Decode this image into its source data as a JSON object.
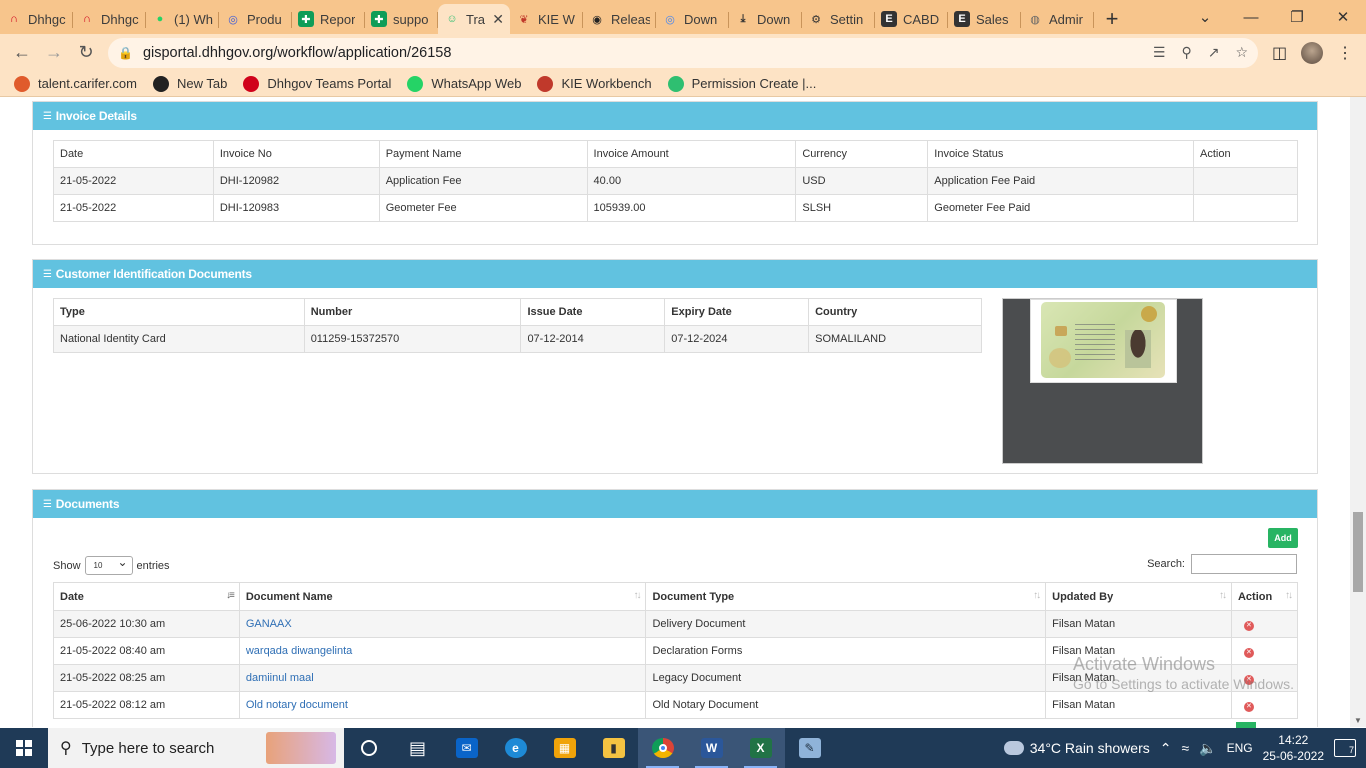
{
  "browser": {
    "tabs": [
      {
        "label": "Dhhgc",
        "icon": "dhhgov-icon",
        "color": "#d0021b"
      },
      {
        "label": "Dhhgc",
        "icon": "dhhgov-icon",
        "color": "#d0021b"
      },
      {
        "label": "(1) Wh",
        "icon": "whatsapp-icon",
        "color": "#25d366"
      },
      {
        "label": "Produ",
        "icon": "product-icon",
        "color": "#3b5bdb"
      },
      {
        "label": "Repor",
        "icon": "sheets-icon",
        "color": "#0f9d58"
      },
      {
        "label": "suppo",
        "icon": "sheets-icon",
        "color": "#0f9d58"
      },
      {
        "label": "Tra",
        "icon": "trello-icon",
        "color": "#2fbf71",
        "active": true
      },
      {
        "label": "KIE W",
        "icon": "kie-icon",
        "color": "#c0392b"
      },
      {
        "label": "Releas",
        "icon": "github-icon",
        "color": "#222222"
      },
      {
        "label": "Down",
        "icon": "chrome-icon",
        "color": "#4285f4"
      },
      {
        "label": "Down",
        "icon": "download-icon",
        "color": "#333333"
      },
      {
        "label": "Settin",
        "icon": "gear-icon",
        "color": "#333333"
      },
      {
        "label": "CABD",
        "icon": "e-icon",
        "color": "#333333"
      },
      {
        "label": "Sales",
        "icon": "e-icon",
        "color": "#333333"
      },
      {
        "label": "Admir",
        "icon": "globe-icon",
        "color": "#666666"
      }
    ],
    "url": "gisportal.dhhgov.org/workflow/application/26158",
    "bookmarks": [
      {
        "label": "talent.carifer.com",
        "color": "#e05b2c"
      },
      {
        "label": "New Tab",
        "color": "#222222"
      },
      {
        "label": "Dhhgov Teams Portal",
        "color": "#d0021b"
      },
      {
        "label": "WhatsApp Web",
        "color": "#25d366"
      },
      {
        "label": "KIE Workbench",
        "color": "#c0392b"
      },
      {
        "label": "Permission Create |...",
        "color": "#2fbf71"
      }
    ]
  },
  "invoice": {
    "title": "Invoice Details",
    "headers": [
      "Date",
      "Invoice No",
      "Payment Name",
      "Invoice Amount",
      "Currency",
      "Invoice Status",
      "Action"
    ],
    "rows": [
      [
        "21-05-2022",
        "DHI-120982",
        "Application Fee",
        "40.00",
        "USD",
        "Application Fee Paid",
        ""
      ],
      [
        "21-05-2022",
        "DHI-120983",
        "Geometer Fee",
        "105939.00",
        "SLSH",
        "Geometer Fee Paid",
        ""
      ]
    ]
  },
  "customer_id": {
    "title": "Customer Identification Documents",
    "headers": [
      "Type",
      "Number",
      "Issue Date",
      "Expiry Date",
      "Country"
    ],
    "rows": [
      [
        "National Identity Card",
        "011259-15372570",
        "07-12-2014",
        "07-12-2024",
        "SOMALILAND"
      ]
    ]
  },
  "documents": {
    "title": "Documents",
    "add_label": "Add",
    "show_label": "Show",
    "entries_value": "10",
    "entries_label": "entries",
    "search_label": "Search:",
    "headers": [
      "Date",
      "Document Name",
      "Document Type",
      "Updated By",
      "Action"
    ],
    "rows": [
      [
        "25-06-2022 10:30 am",
        "GANAAX",
        "Delivery Document",
        "Filsan Matan"
      ],
      [
        "21-05-2022 08:40 am",
        "warqada diwangelinta",
        "Declaration Forms",
        "Filsan Matan"
      ],
      [
        "21-05-2022 08:25 am",
        "damiinul maal",
        "Legacy Document",
        "Filsan Matan"
      ],
      [
        "21-05-2022 08:12 am",
        "Old notary document",
        "Old Notary Document",
        "Filsan Matan"
      ]
    ]
  },
  "watermark": {
    "line1": "Activate Windows",
    "line2": "Go to Settings to activate Windows."
  },
  "taskbar": {
    "search_placeholder": "Type here to search",
    "weather": "34°C  Rain showers",
    "language": "ENG",
    "time": "14:22",
    "date": "25-06-2022",
    "notifications": "7"
  }
}
